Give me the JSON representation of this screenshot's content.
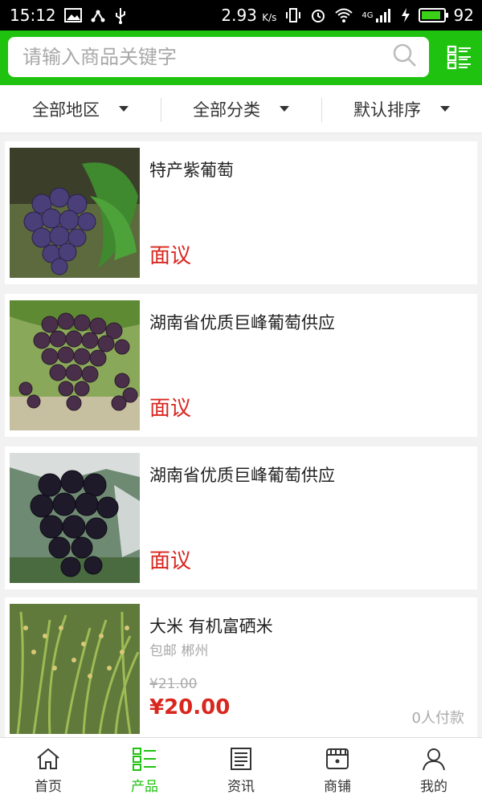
{
  "status_bar": {
    "time": "15:12",
    "speed": "2.93",
    "speed_unit": "K/s",
    "network": "4G",
    "battery": "92",
    "battery_level": 0.92
  },
  "search": {
    "placeholder": "请输入商品关键字"
  },
  "filters": [
    {
      "label": "全部地区"
    },
    {
      "label": "全部分类"
    },
    {
      "label": "默认排序"
    }
  ],
  "products": [
    {
      "title": "特产紫葡萄",
      "price": "面议"
    },
    {
      "title": "湖南省优质巨峰葡萄供应",
      "price": "面议"
    },
    {
      "title": "湖南省优质巨峰葡萄供应",
      "price": "面议"
    },
    {
      "title": "大米 有机富硒米",
      "meta": "包邮 郴州",
      "old_price": "¥21.00",
      "price": "¥20.00",
      "paid": "0人付款"
    }
  ],
  "bottom_nav": [
    {
      "label": "首页",
      "icon": "home-icon",
      "active": false
    },
    {
      "label": "产品",
      "icon": "list-icon",
      "active": true
    },
    {
      "label": "资讯",
      "icon": "news-icon",
      "active": false
    },
    {
      "label": "商铺",
      "icon": "store-icon",
      "active": false
    },
    {
      "label": "我的",
      "icon": "user-icon",
      "active": false
    }
  ],
  "colors": {
    "brand": "#1fc30f",
    "price": "#d9271f"
  }
}
